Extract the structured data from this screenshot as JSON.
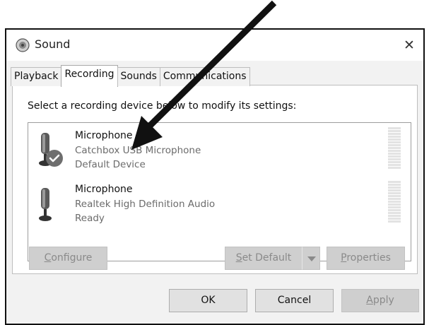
{
  "window": {
    "title": "Sound",
    "close_label": "✕"
  },
  "tabs": [
    {
      "label": "Playback",
      "active": false
    },
    {
      "label": "Recording",
      "active": true
    },
    {
      "label": "Sounds",
      "active": false
    },
    {
      "label": "Communications",
      "active": false
    }
  ],
  "instruction": "Select a recording device below to modify its settings:",
  "devices": [
    {
      "name": "Microphone",
      "description": "Catchbox USB Microphone",
      "status": "Default Device",
      "is_default": true,
      "icon": "microphone-icon"
    },
    {
      "name": "Microphone",
      "description": "Realtek High Definition Audio",
      "status": "Ready",
      "is_default": false,
      "icon": "microphone-icon"
    }
  ],
  "buttons": {
    "configure": {
      "label": "Configure",
      "mnemonic": "C",
      "rest": "onfigure",
      "enabled": false
    },
    "set_default": {
      "label": "Set Default",
      "mnemonic": "S",
      "rest": "et Default",
      "enabled": false
    },
    "properties": {
      "label": "Properties",
      "mnemonic": "P",
      "rest": "roperties",
      "enabled": false
    },
    "ok": {
      "label": "OK",
      "enabled": true
    },
    "cancel": {
      "label": "Cancel",
      "enabled": true
    },
    "apply": {
      "label": "Apply",
      "mnemonic": "A",
      "rest": "pply",
      "enabled": false
    }
  },
  "colors": {
    "default_check_badge": "#6e6e6e",
    "annotation_arrow": "#111111"
  }
}
